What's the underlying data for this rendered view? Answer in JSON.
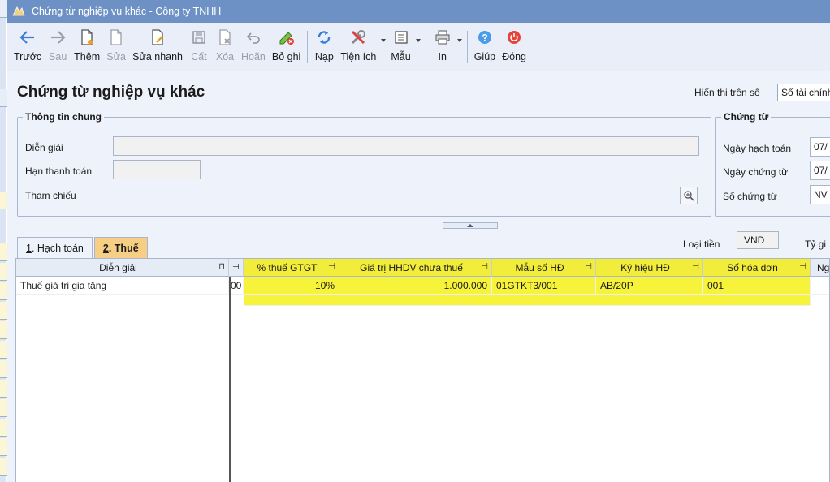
{
  "window": {
    "title": "Chứng từ nghiệp vụ khác - Công ty TNHH"
  },
  "toolbar": {
    "buttons": [
      {
        "label": "Trước",
        "icon": "arrow-left-icon",
        "disabled": false
      },
      {
        "label": "Sau",
        "icon": "arrow-right-icon",
        "disabled": true
      },
      {
        "label": "Thêm",
        "icon": "add-document-icon",
        "disabled": false
      },
      {
        "label": "Sửa",
        "icon": "edit-document-icon",
        "disabled": true
      },
      {
        "label": "Sửa nhanh",
        "icon": "quick-edit-icon",
        "disabled": false
      },
      {
        "label": "Cất",
        "icon": "save-icon",
        "disabled": true
      },
      {
        "label": "Xóa",
        "icon": "delete-icon",
        "disabled": true
      },
      {
        "label": "Hoãn",
        "icon": "undo-icon",
        "disabled": true
      },
      {
        "label": "Bỏ ghi",
        "icon": "unpost-icon",
        "disabled": false
      },
      {
        "label": "Nạp",
        "icon": "refresh-icon",
        "disabled": false
      },
      {
        "label": "Tiện ích",
        "icon": "tools-icon",
        "disabled": false
      },
      {
        "label": "Mẫu",
        "icon": "template-icon",
        "disabled": false
      },
      {
        "label": "In",
        "icon": "printer-icon",
        "disabled": false
      },
      {
        "label": "Giúp",
        "icon": "help-icon",
        "disabled": false
      },
      {
        "label": "Đóng",
        "icon": "power-icon",
        "disabled": false
      }
    ]
  },
  "page": {
    "title": "Chứng từ nghiệp vụ khác",
    "display_on_label": "Hiển thị trên sổ",
    "display_on_value": "Sổ tài chính"
  },
  "general": {
    "legend": "Thông tin chung",
    "description_label": "Diễn giải",
    "description_value": "",
    "due_date_label": "Hạn thanh toán",
    "due_date_value": "",
    "reference_label": "Tham chiếu"
  },
  "voucher": {
    "legend": "Chứng từ",
    "posting_date_label": "Ngày hạch toán",
    "posting_date_value": "07/",
    "voucher_date_label": "Ngày chứng từ",
    "voucher_date_value": "07/",
    "voucher_no_label": "Số chứng từ",
    "voucher_no_value": "NV"
  },
  "tabs": [
    {
      "key": "1",
      "label": "Hạch toán",
      "active": false
    },
    {
      "key": "2",
      "label": "Thuế",
      "active": true
    }
  ],
  "currency": {
    "label": "Loại tiền",
    "value": "VND",
    "rate_label": "Tỷ gi"
  },
  "grid": {
    "columns": [
      {
        "name": "description",
        "title": "Diễn giải"
      },
      {
        "name": "vat_rate",
        "title": "% thuế GTGT"
      },
      {
        "name": "pre_tax_value",
        "title": "Giá trị HHDV chưa thuế"
      },
      {
        "name": "invoice_template",
        "title": "Mẫu số HĐ"
      },
      {
        "name": "invoice_series",
        "title": "Ký hiệu HĐ"
      },
      {
        "name": "invoice_no",
        "title": "Số hóa đơn"
      },
      {
        "name": "invoice_date",
        "title": "Ng"
      }
    ],
    "rows": [
      {
        "description": "Thuế giá trị gia tăng",
        "hidden_fragment": "00",
        "vat_rate": "10%",
        "pre_tax_value": "1.000.000",
        "invoice_template": "01GTKT3/001",
        "invoice_series": "AB/20P",
        "invoice_no": "001"
      }
    ]
  },
  "colors": {
    "title_bar": "#6d91c4",
    "highlight": "#f2ec3a",
    "active_tab": "#f7cf84"
  }
}
